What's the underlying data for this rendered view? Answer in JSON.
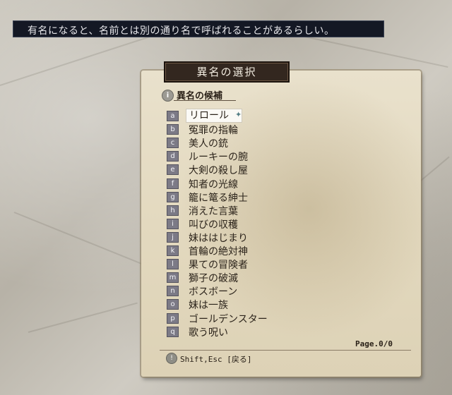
{
  "message": "有名になると、名前とは別の通り名で呼ばれることがあるらしい。",
  "panel": {
    "title": "異名の選択",
    "section_label": "異名の候補",
    "selected_index": 0,
    "items": [
      {
        "key": "a",
        "name": "リロール"
      },
      {
        "key": "b",
        "name": "冤罪の指輪"
      },
      {
        "key": "c",
        "name": "美人の銃"
      },
      {
        "key": "d",
        "name": "ルーキーの腕"
      },
      {
        "key": "e",
        "name": "大剣の殺し屋"
      },
      {
        "key": "f",
        "name": "知者の光線"
      },
      {
        "key": "g",
        "name": "籠に篭る紳士"
      },
      {
        "key": "h",
        "name": "消えた言葉"
      },
      {
        "key": "i",
        "name": "叫びの収穫"
      },
      {
        "key": "j",
        "name": "妹ははじまり"
      },
      {
        "key": "k",
        "name": "首輪の絶対神"
      },
      {
        "key": "l",
        "name": "果ての冒険者"
      },
      {
        "key": "m",
        "name": "獅子の破滅"
      },
      {
        "key": "n",
        "name": "ボスボーン"
      },
      {
        "key": "o",
        "name": "妹は一族"
      },
      {
        "key": "p",
        "name": "ゴールデンスター"
      },
      {
        "key": "q",
        "name": "歌う呪い"
      }
    ],
    "page": "Page.0/0",
    "hint": "Shift,Esc [戻る]"
  }
}
